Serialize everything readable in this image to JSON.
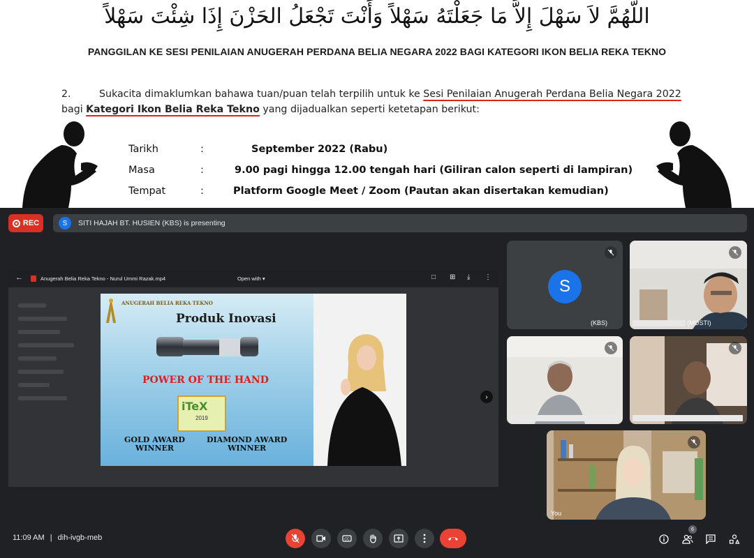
{
  "document": {
    "doa": "اللَّهُمَّ لاَ سَهْلَ إِلاَّ مَا جَعَلْتَهُ سَهْلاً وَأَنْتَ تَجْعَلُ الحَزْنَ إِذَا شِئْتَ سَهْلاً",
    "title": "PANGGILAN KE SESI PENILAIAN ANUGERAH PERDANA BELIA NEGARA 2022 BAGI KATEGORI IKON BELIA REKA TEKNO",
    "paragraph": {
      "number": "2.",
      "text_before": "Sukacita dimaklumkan bahawa tuan/puan telah terpilih untuk ke ",
      "highlight_1": "Sesi Penilaian Anugerah Perdana Belia Negara 2022",
      "text_middle": "bagi ",
      "highlight_2": "Kategori Ikon Belia Reka Tekno",
      "text_after": " yang dijadualkan seperti ketetapan berikut:"
    },
    "schedule": [
      {
        "label": "Tarikh",
        "colon": ":",
        "value": "September 2022 (Rabu)"
      },
      {
        "label": "Masa",
        "colon": ":",
        "value": "9.00 pagi hingga 12.00 tengah hari (Giliran calon seperti di lampiran)"
      },
      {
        "label": "Tempat",
        "colon": ":",
        "value": "Platform Google Meet / Zoom (Pautan akan disertakan kemudian)"
      }
    ]
  },
  "meet": {
    "rec_label": "REC",
    "presenter_initial": "S",
    "presenting_text": "SITI HAJAH BT. HUSIEN (KBS) is presenting",
    "shared_screen": {
      "file_name": "Anugerah Belia Reka Tekno - Nurul Ummi Razak.mp4",
      "open_with": "Open with",
      "slide": {
        "logo_text": "ANUGERAH BELIA REKA TEKNO",
        "title": "Produk Inovasi",
        "product_caption": "POWER OF THE HAND",
        "award_year": "2019",
        "award_left": [
          "GOLD AWARD",
          "WINNER"
        ],
        "award_right": [
          "DIAMOND AWARD",
          "WINNER"
        ]
      }
    },
    "participants": [
      {
        "name": "(KBS)",
        "initial": "S",
        "avatar_color": "#1a73e8"
      },
      {
        "name": "(MOSTI)"
      },
      {
        "name": ""
      },
      {
        "name": ""
      },
      {
        "name": "You"
      }
    ],
    "bottom_bar": {
      "time": "11:09 AM",
      "separator": "|",
      "meeting_code": "dih-ivgb-meb",
      "participant_count": "6"
    }
  }
}
